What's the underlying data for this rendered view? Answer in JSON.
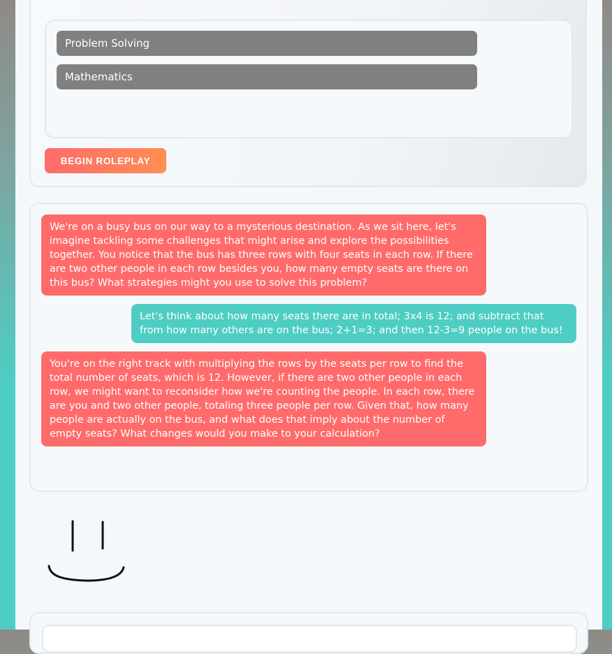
{
  "skills": {
    "items": [
      "Problem Solving",
      "Mathematics"
    ]
  },
  "actions": {
    "begin_label": "BEGIN ROLEPLAY"
  },
  "chat": {
    "messages": [
      {
        "role": "ai",
        "text": "We're on a busy bus on our way to a mysterious destination. As we sit here, let's imagine tackling some challenges that might arise and explore the possibilities together. You notice that the bus has three rows with four seats in each row. If there are two other people in each row besides you, how many empty seats are there on this bus? What strategies might you use to solve this problem?"
      },
      {
        "role": "user",
        "text": "Let's think about how many seats there are in total; 3x4 is 12; and subtract that from how many others are on the bus; 2+1=3; and then 12-3=9 people on the bus!"
      },
      {
        "role": "ai",
        "text": "You're on the right track with multiplying the rows by the seats per row to find the total number of seats, which is 12. However, if there are two other people in each row, we might want to reconsider how we're counting the people. In each row, there are you and two other people, totaling three people per row. Given that, how many people are actually on the bus, and what does that imply about the number of empty seats? What changes would you make to your calculation?"
      }
    ]
  },
  "colors": {
    "ai_bubble": "#ff6b6b",
    "user_bubble": "#4ecdc4",
    "accent_gradient_end": "#ff8e53",
    "chip": "#808080"
  }
}
